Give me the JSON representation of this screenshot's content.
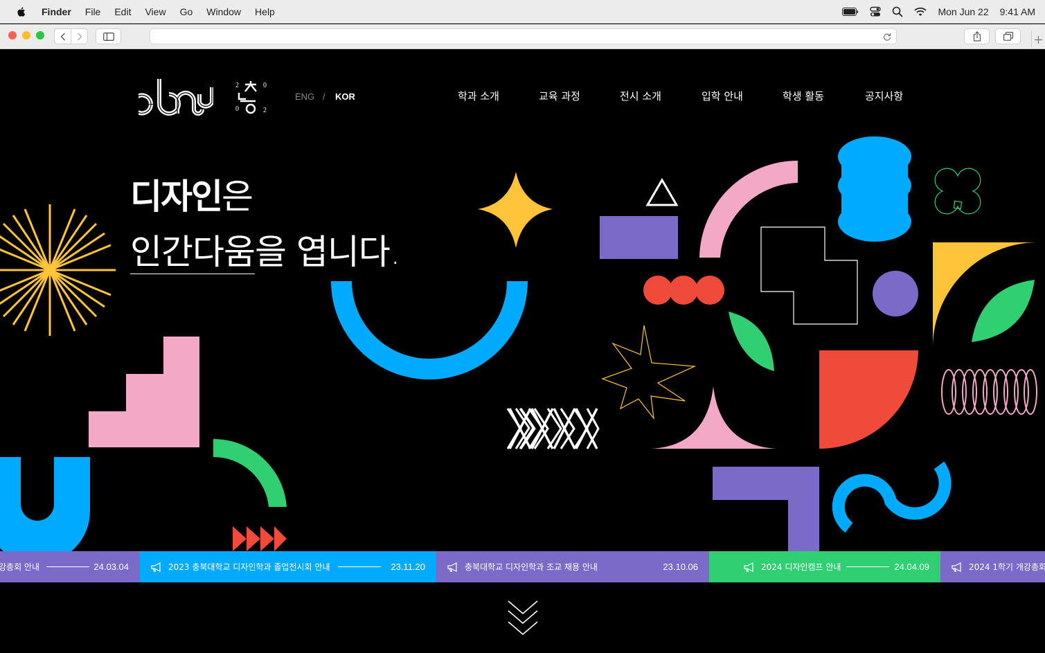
{
  "menubar": {
    "app": "Finder",
    "items": [
      "File",
      "Edit",
      "View",
      "Go",
      "Window",
      "Help"
    ],
    "date": "Mon Jun 22",
    "time": "9:41 AM"
  },
  "browser": {
    "url": ""
  },
  "site": {
    "logo_alt": "cbnu",
    "lang_eng": "ENG",
    "lang_sep": "/",
    "lang_kor": "KOR",
    "nav": [
      "학과 소개",
      "교육 과정",
      "전시 소개",
      "입학 안내",
      "학생 활동",
      "공지사항"
    ],
    "hero_line1_bold": "디자인",
    "hero_line1_light": "은",
    "hero_line2_underlined": "인간다움",
    "hero_line2_rest": "을 엽니다."
  },
  "notices": [
    {
      "title": "강총회 안내",
      "date": "24.03.04",
      "color": "#7c6ac8"
    },
    {
      "title": "2023 충북대학교 디자인학과 졸업전시회 안내",
      "date": "23.11.20",
      "color": "#00aaff"
    },
    {
      "title": "충북대학교 디자인학과 조교 채용 안내",
      "date": "23.10.06",
      "color": "#7c6ac8"
    },
    {
      "title": "2024 디자인캠프 안내",
      "date": "24.04.09",
      "color": "#2fcf72"
    },
    {
      "title": "2024 1학기 개강총회 안내",
      "date": "",
      "color": "#7c6ac8"
    }
  ]
}
